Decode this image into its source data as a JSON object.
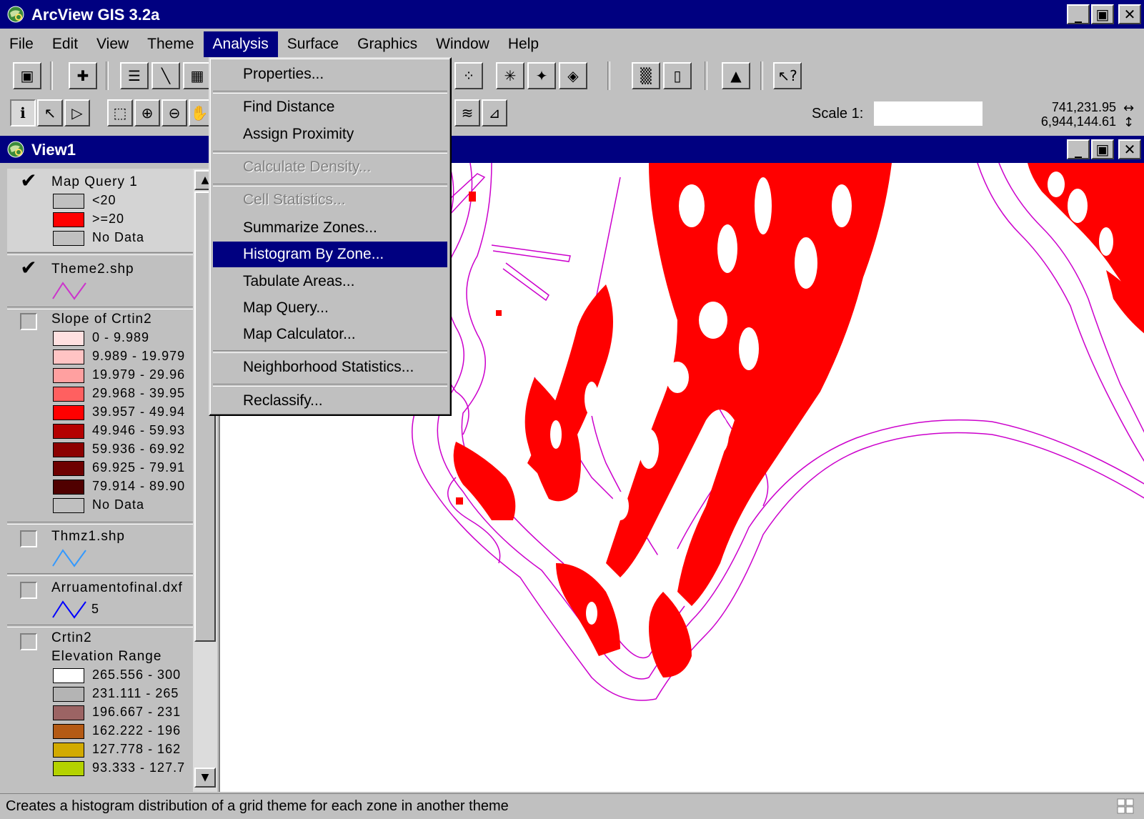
{
  "app": {
    "title": "ArcView GIS 3.2a",
    "window_buttons": [
      "minimize",
      "restore",
      "close"
    ]
  },
  "menubar": {
    "items": [
      "File",
      "Edit",
      "View",
      "Theme",
      "Analysis",
      "Surface",
      "Graphics",
      "Window",
      "Help"
    ],
    "active": "Analysis"
  },
  "analysis_menu": {
    "items": [
      {
        "label": "Properties...",
        "enabled": true
      },
      {
        "label": "Find Distance",
        "enabled": true
      },
      {
        "label": "Assign Proximity",
        "enabled": true
      },
      {
        "label": "Calculate Density...",
        "enabled": false
      },
      {
        "label": "Cell Statistics...",
        "enabled": false
      },
      {
        "label": "Summarize Zones...",
        "enabled": true
      },
      {
        "label": "Histogram By Zone...",
        "enabled": true,
        "highlighted": true
      },
      {
        "label": "Tabulate Areas...",
        "enabled": true
      },
      {
        "label": "Map Query...",
        "enabled": true
      },
      {
        "label": "Map Calculator...",
        "enabled": true
      },
      {
        "label": "Neighborhood Statistics...",
        "enabled": true
      },
      {
        "label": "Reclassify...",
        "enabled": true
      }
    ]
  },
  "toolbar": {
    "scale_label": "Scale 1:",
    "scale_value": "",
    "coord_x": "741,231.95",
    "coord_y": "6,944,144.61"
  },
  "view": {
    "title": "View1"
  },
  "toc": {
    "themes": [
      {
        "name": "Map Query 1",
        "checked": true,
        "legend": [
          {
            "label": "<20",
            "color": "#c0c0c0"
          },
          {
            "label": ">=20",
            "color": "#ff0000"
          },
          {
            "label": "No Data",
            "color": "#c0c0c0"
          }
        ]
      },
      {
        "name": "Theme2.shp",
        "checked": true,
        "line_color": "#cc33cc"
      },
      {
        "name": "Slope of Crtin2",
        "checked": false,
        "legend": [
          {
            "label": "0 - 9.989",
            "color": "#ffe0e0"
          },
          {
            "label": "9.989 - 19.979",
            "color": "#ffc4c4"
          },
          {
            "label": "19.979 - 29.96",
            "color": "#ffa0a0"
          },
          {
            "label": "29.968 - 39.95",
            "color": "#ff6060"
          },
          {
            "label": "39.957 - 49.94",
            "color": "#ff0000"
          },
          {
            "label": "49.946 - 59.93",
            "color": "#b40000"
          },
          {
            "label": "59.936 - 69.92",
            "color": "#8c0000"
          },
          {
            "label": "69.925 - 79.91",
            "color": "#6e0000"
          },
          {
            "label": "79.914 - 89.90",
            "color": "#500000"
          },
          {
            "label": "No Data",
            "color": "#c0c0c0"
          }
        ]
      },
      {
        "name": "Thmz1.shp",
        "checked": false,
        "line_color": "#3399ff"
      },
      {
        "name": "Arruamentofinal.dxf",
        "checked": false,
        "line_color": "#0000ff",
        "line_label": "5"
      },
      {
        "name": "Crtin2",
        "checked": false,
        "subtitle": "Elevation Range",
        "legend": [
          {
            "label": "265.556 - 300",
            "color": "#ffffff"
          },
          {
            "label": "231.111 - 265",
            "color": "#b4b4b4"
          },
          {
            "label": "196.667 - 231",
            "color": "#9c6464"
          },
          {
            "label": "162.222 - 196",
            "color": "#b45a14"
          },
          {
            "label": "127.778 - 162",
            "color": "#d2aa00"
          },
          {
            "label": "93.333 - 127.7",
            "color": "#b4d200"
          }
        ]
      }
    ]
  },
  "status": {
    "text": "Creates a histogram distribution of a grid theme for each zone in another theme"
  },
  "colors": {
    "titlebar": "#000080",
    "face": "#c0c0c0",
    "map_fill": "#ff0000",
    "map_contour": "#cc00cc"
  }
}
